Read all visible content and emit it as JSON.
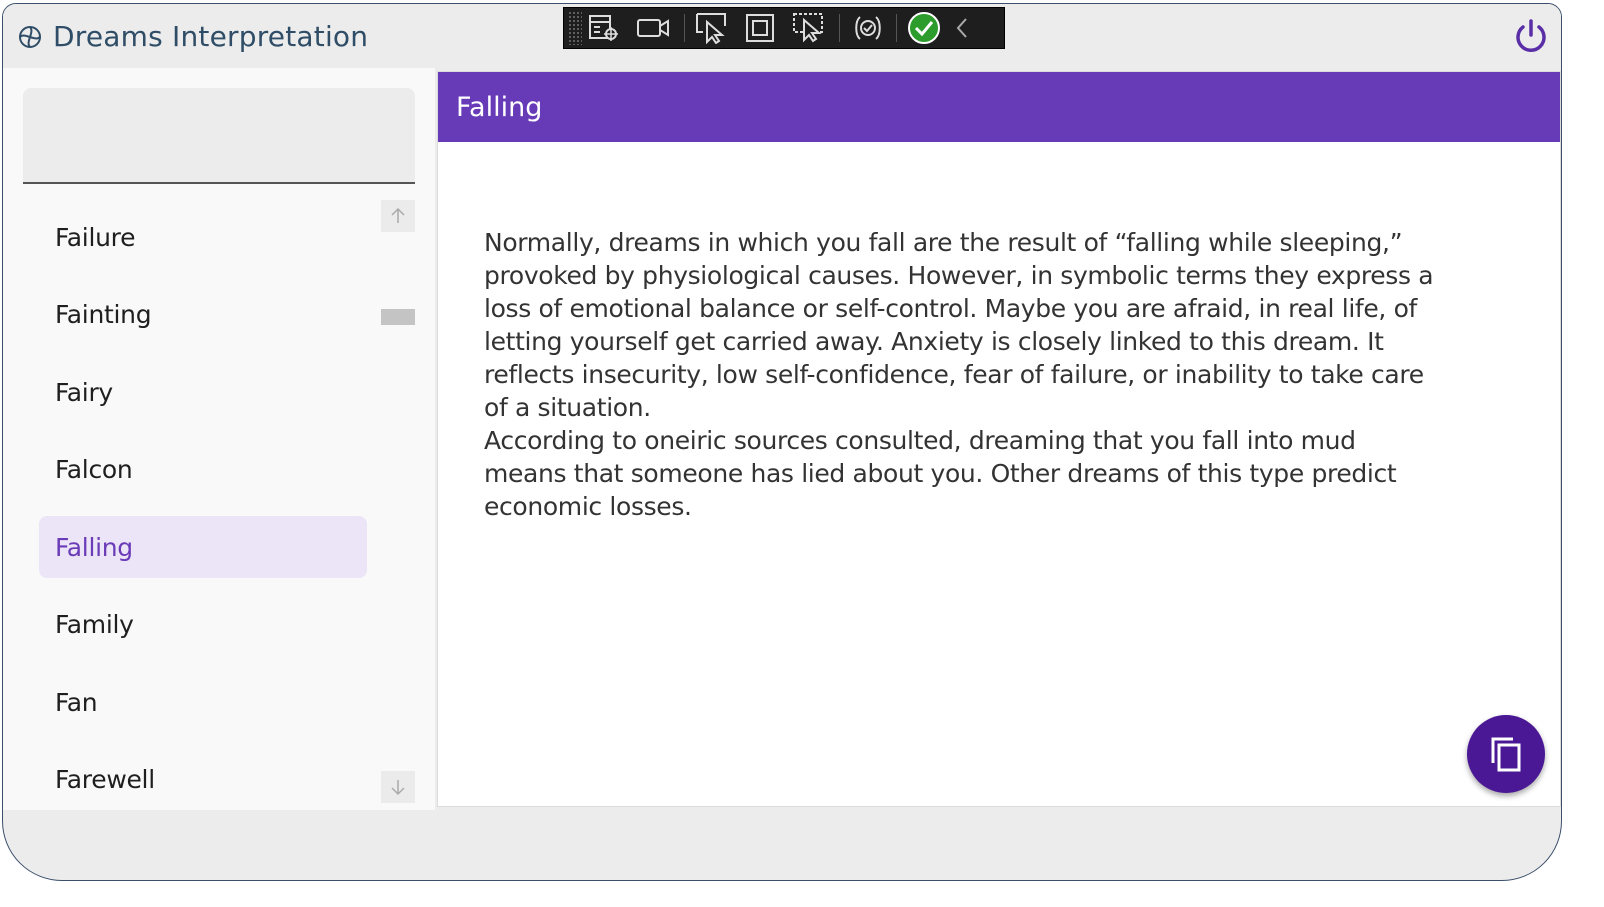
{
  "app": {
    "title": "Dreams Interpretation",
    "accent_color": "#673ab7",
    "fab_color": "#4a1795"
  },
  "titlebar": {
    "power_icon": "power-icon"
  },
  "debug_toolbar": {
    "items": [
      "live-visual-tree-icon",
      "video-camera-icon",
      "select-element-icon",
      "display-layout-adorners-icon",
      "track-focused-element-icon",
      "hot-reload-icon",
      "binding-status-ok-icon",
      "collapse-chevron-icon"
    ]
  },
  "sidebar": {
    "search": {
      "value": "",
      "placeholder": ""
    },
    "items": [
      {
        "label": "Failure"
      },
      {
        "label": "Fainting"
      },
      {
        "label": "Fairy"
      },
      {
        "label": "Falcon"
      },
      {
        "label": "Falling",
        "selected": true
      },
      {
        "label": "Family"
      },
      {
        "label": "Fan"
      },
      {
        "label": "Farewell"
      }
    ]
  },
  "detail": {
    "title": "Falling",
    "paragraphs": [
      "Normally, dreams in which you fall are the result of “falling while sleeping,” provoked by physiological causes. However, in symbolic terms they express a loss of emotional balance or self-control. Maybe you are afraid, in real life, of letting yourself get carried away. Anxiety is closely linked to this dream. It reflects insecurity, low self-confidence, fear of failure, or inability to take care of a situation.",
      "According to oneiric sources consulted, dreaming that you fall into mud means that someone has lied about you. Other dreams of this type predict economic losses."
    ]
  },
  "fab": {
    "icon": "copy-icon"
  }
}
